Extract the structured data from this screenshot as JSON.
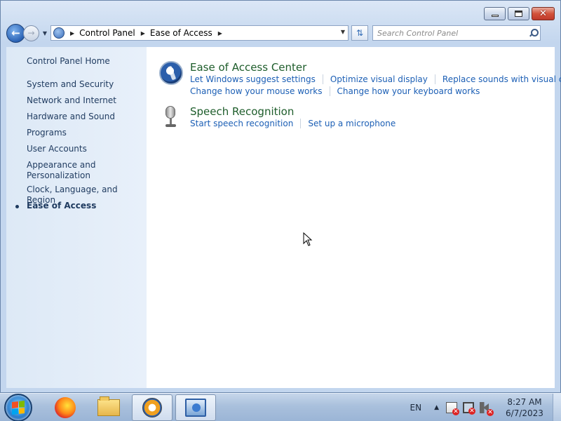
{
  "window": {
    "caption": {
      "minimize": "minimize",
      "maximize": "restore",
      "close": "✕"
    }
  },
  "navbar": {
    "breadcrumb": [
      "Control Panel",
      "Ease of Access"
    ],
    "search_placeholder": "Search Control Panel"
  },
  "sidebar": {
    "home": "Control Panel Home",
    "items": [
      {
        "label": "System and Security"
      },
      {
        "label": "Network and Internet"
      },
      {
        "label": "Hardware and Sound"
      },
      {
        "label": "Programs"
      },
      {
        "label": "User Accounts"
      },
      {
        "label": "Appearance and\nPersonalization"
      },
      {
        "label": "Clock, Language, and Region"
      },
      {
        "label": "Ease of Access",
        "active": true
      }
    ]
  },
  "main": {
    "categories": [
      {
        "title": "Ease of Access Center",
        "icon": "ease-of-access-icon",
        "links": [
          [
            "Let Windows suggest settings",
            "Optimize visual display",
            "Replace sounds with visual cues"
          ],
          [
            "Change how your mouse works",
            "Change how your keyboard works"
          ]
        ]
      },
      {
        "title": "Speech Recognition",
        "icon": "microphone-icon",
        "links": [
          [
            "Start speech recognition",
            "Set up a microphone"
          ]
        ]
      }
    ]
  },
  "taskbar": {
    "apps": [
      "firefox-icon",
      "file-explorer-icon",
      "ease-of-access-center-icon",
      "control-panel-icon"
    ],
    "tray": {
      "language": "EN",
      "time": "8:27 AM",
      "date": "6/7/2023"
    }
  },
  "colors": {
    "link": "#1c5fb5",
    "category_title": "#1e5d2b",
    "sidebar_text": "#1e3a5f"
  }
}
